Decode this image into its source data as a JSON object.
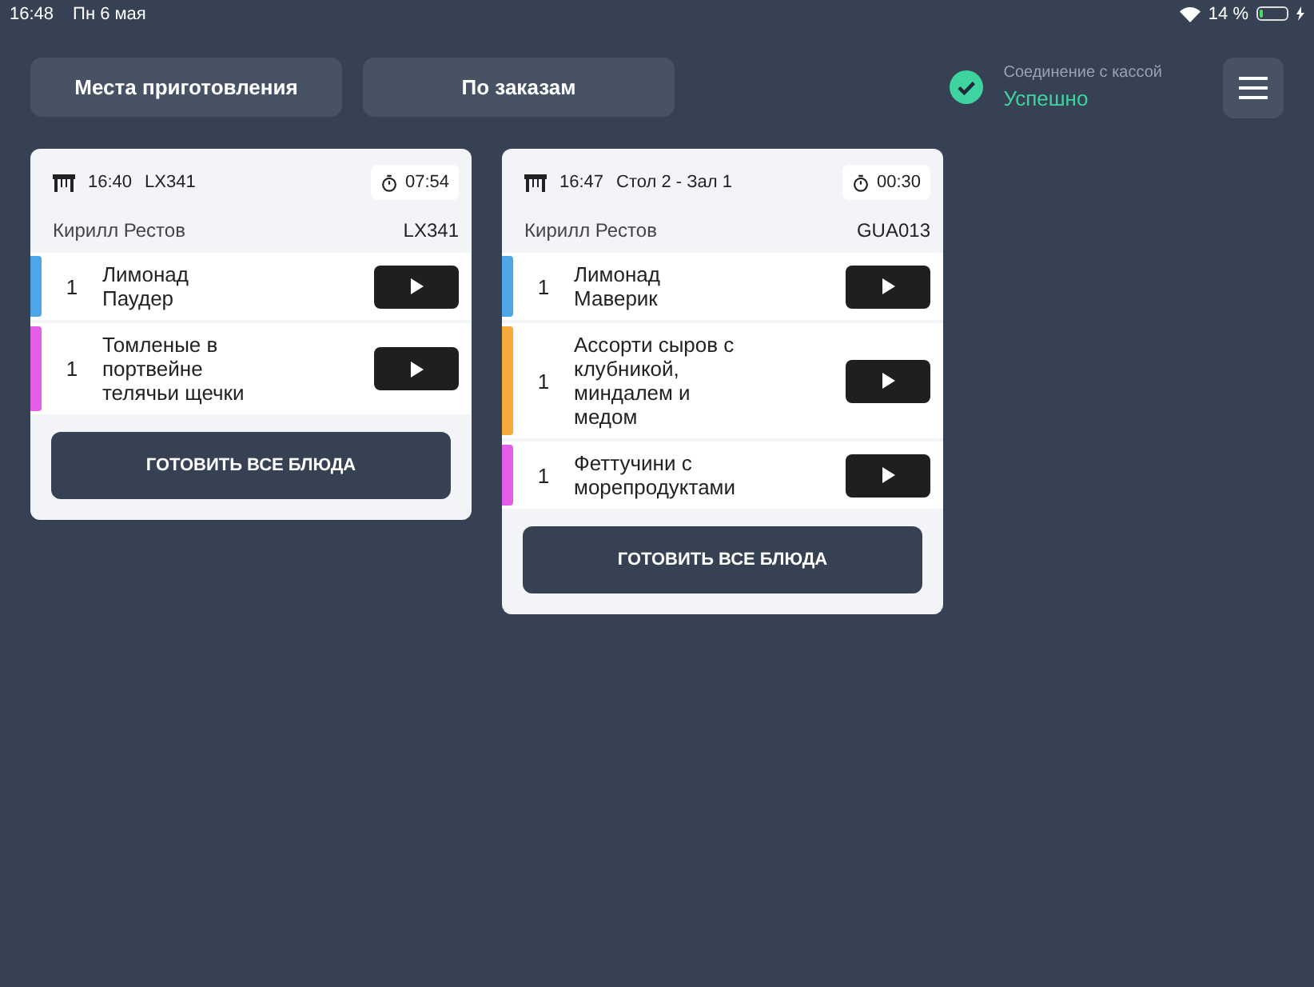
{
  "status_bar": {
    "time": "16:48",
    "date": "Пн 6 мая",
    "battery_text": "14 %",
    "battery": {
      "level": 0.14
    }
  },
  "nav": [
    {
      "label": "Места приготовления",
      "selected": false
    },
    {
      "label": "По заказам",
      "selected": false
    }
  ],
  "connection": {
    "label": "Соединение с кассой",
    "status": "Успешно",
    "ok": true
  },
  "orders": [
    {
      "time": "16:40",
      "place": "LX341",
      "timer": "07:54",
      "waiter": "Кирилл Рестов",
      "code": "LX341",
      "items": [
        {
          "qty": "1",
          "name": "Лимонад Паудер",
          "color": "#4da6e8"
        },
        {
          "qty": "1",
          "name": "Томленые в портвейне телячьи щечки",
          "color": "#e45ee8"
        }
      ],
      "button": "ГОТОВИТЬ ВСЕ БЛЮДА"
    },
    {
      "time": "16:47",
      "place": "Стол 2 - Зал 1",
      "timer": "00:30",
      "waiter": "Кирилл Рестов",
      "code": "GUA013",
      "items": [
        {
          "qty": "1",
          "name": "Лимонад Маверик",
          "color": "#4da6e8"
        },
        {
          "qty": "1",
          "name": "Ассорти сыров с клубникой, миндалем и медом",
          "color": "#f8a93a"
        },
        {
          "qty": "1",
          "name": "Феттучини с морепродуктами",
          "color": "#e45ee8"
        }
      ],
      "button": "ГОТОВИТЬ ВСЕ БЛЮДА"
    }
  ]
}
